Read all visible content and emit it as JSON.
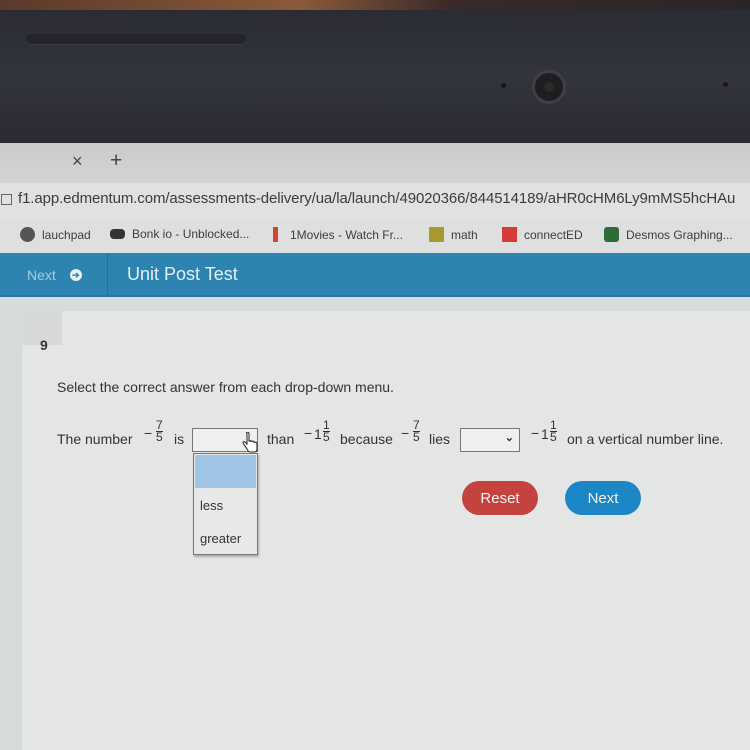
{
  "browser": {
    "tab_close_icon": "×",
    "new_tab_icon": "+",
    "url": "f1.app.edmentum.com/assessments-delivery/ua/la/launch/49020366/844514189/aHR0cHM6Ly9mMS5hcHAu",
    "bookmarks": [
      {
        "label": "lauchpad",
        "icon": "globe-icon"
      },
      {
        "label": "Bonk io - Unblocked...",
        "icon": "gamepad-icon"
      },
      {
        "label": "1Movies - Watch Fr...",
        "icon": "movies-icon"
      },
      {
        "label": "math",
        "icon": "classroom-icon"
      },
      {
        "label": "connectED",
        "icon": "mcgraw-hill-icon"
      },
      {
        "label": "Desmos Graphing...",
        "icon": "desmos-icon"
      }
    ]
  },
  "appbar": {
    "next_label": "Next",
    "title": "Unit Post Test",
    "color": "#2e84b0"
  },
  "question": {
    "number": "9",
    "instruction": "Select the correct answer from each drop-down menu.",
    "part1": "The number",
    "frac1": {
      "sign": "−",
      "num": "7",
      "den": "5"
    },
    "part2": "is",
    "part3": "than",
    "mixed1": {
      "sign": "−",
      "whole": "1",
      "num": "1",
      "den": "5"
    },
    "part4": "because",
    "frac2": {
      "sign": "−",
      "num": "7",
      "den": "5"
    },
    "part5": "lies",
    "mixed2": {
      "sign": "−",
      "whole": "1",
      "num": "1",
      "den": "5"
    },
    "part6": "on a vertical number line.",
    "dropdown1": {
      "value": "",
      "open": true,
      "options": [
        "",
        "less",
        "greater"
      ]
    },
    "dropdown2": {
      "value": "",
      "chevron": "⌄"
    }
  },
  "buttons": {
    "reset_label": "Reset",
    "next_label": "Next",
    "reset_color": "#c4433e",
    "next_color": "#1d86c6"
  }
}
